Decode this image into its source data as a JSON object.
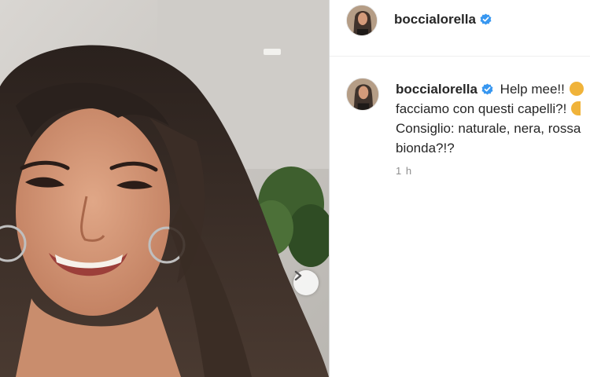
{
  "post": {
    "username": "boccialorella",
    "verified": true,
    "caption_lines": [
      "Help mee!!",
      "facciamo con questi capelli?!",
      "Consiglio: naturale, nera, rossa",
      "bionda?!?"
    ],
    "timestamp": "1 h"
  },
  "icons": {
    "verified": "verified-badge-icon",
    "next": "chevron-right-icon"
  },
  "colors": {
    "verified_blue": "#3897f0",
    "text": "#262626",
    "muted": "#8e8e8e",
    "divider": "#dbdbdb"
  }
}
